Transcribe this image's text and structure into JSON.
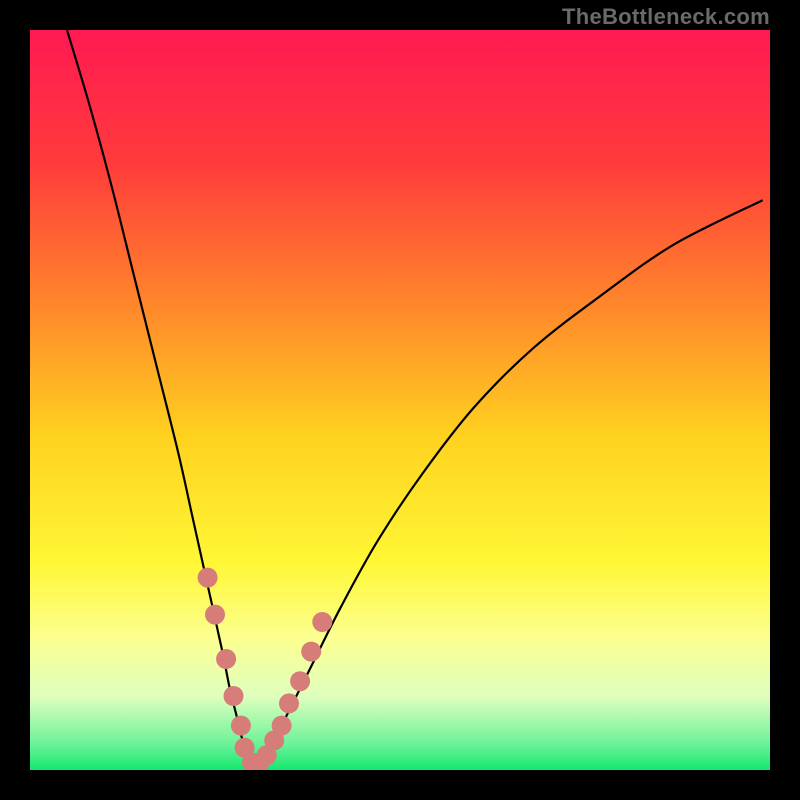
{
  "watermark": "TheBottleneck.com",
  "colors": {
    "black_border": "#000000",
    "curve": "#000000",
    "dot_fill": "#d77d79",
    "dot_stroke": "#d77d79"
  },
  "chart_data": {
    "type": "line",
    "title": "",
    "xlabel": "",
    "ylabel": "",
    "xlim": [
      0,
      100
    ],
    "ylim": [
      0,
      100
    ],
    "grid": false,
    "series": [
      {
        "name": "bottleneck-curve",
        "x": [
          5,
          8,
          11,
          14,
          17,
          20,
          22,
          24,
          26,
          27,
          28,
          29,
          30,
          31,
          32,
          33,
          35,
          38,
          42,
          47,
          53,
          60,
          68,
          77,
          87,
          99
        ],
        "y": [
          100,
          90,
          79,
          67,
          55,
          43,
          34,
          25,
          16,
          11,
          7,
          3,
          1,
          1,
          2,
          4,
          8,
          14,
          22,
          31,
          40,
          49,
          57,
          64,
          71,
          77
        ]
      }
    ],
    "highlight_points": {
      "series": "bottleneck-curve",
      "x": [
        24,
        25,
        26.5,
        27.5,
        28.5,
        29,
        30,
        31,
        32,
        33,
        34,
        35,
        36.5,
        38,
        39.5
      ],
      "y": [
        26,
        21,
        15,
        10,
        6,
        3,
        1,
        1,
        2,
        4,
        6,
        9,
        12,
        16,
        20
      ]
    },
    "gradient_stops": [
      {
        "offset": 0.0,
        "color": "#ff1a52"
      },
      {
        "offset": 0.18,
        "color": "#ff3b3b"
      },
      {
        "offset": 0.38,
        "color": "#ff8a2a"
      },
      {
        "offset": 0.55,
        "color": "#ffd21f"
      },
      {
        "offset": 0.72,
        "color": "#fff735"
      },
      {
        "offset": 0.82,
        "color": "#fcff8f"
      },
      {
        "offset": 0.9,
        "color": "#dfffbe"
      },
      {
        "offset": 0.965,
        "color": "#6cf299"
      },
      {
        "offset": 1.0,
        "color": "#14e86f"
      }
    ]
  }
}
